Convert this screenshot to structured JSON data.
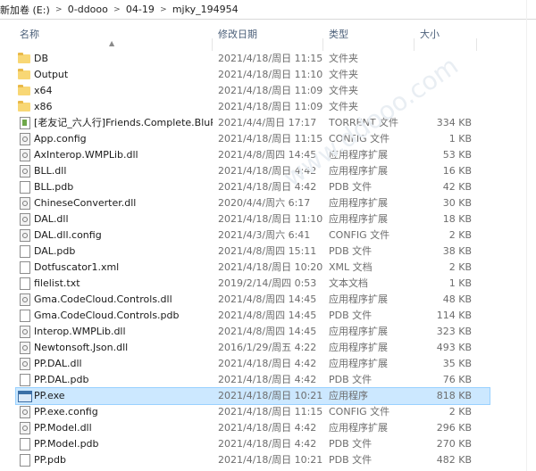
{
  "breadcrumb": [
    "新加卷 (E:)",
    "0-ddooo",
    "04-19",
    "mjky_194954"
  ],
  "columns": {
    "name": "名称",
    "date": "修改日期",
    "type": "类型",
    "size": "大小"
  },
  "watermark": "www.ddooo.com",
  "files": [
    {
      "name": "DB",
      "date": "2021/4/18/周日 11:15",
      "type": "文件夹",
      "size": "",
      "icon": "folder-icon"
    },
    {
      "name": "Output",
      "date": "2021/4/18/周日 11:10",
      "type": "文件夹",
      "size": "",
      "icon": "folder-icon"
    },
    {
      "name": "x64",
      "date": "2021/4/18/周日 11:09",
      "type": "文件夹",
      "size": "",
      "icon": "folder-icon"
    },
    {
      "name": "x86",
      "date": "2021/4/18/周日 11:09",
      "type": "文件夹",
      "size": "",
      "icon": "folder-icon"
    },
    {
      "name": "[老友记_六人行]Friends.Complete.BluR...",
      "date": "2021/4/4/周日 17:17",
      "type": "TORRENT 文件",
      "size": "334 KB",
      "icon": "torrent-file-icon"
    },
    {
      "name": "App.config",
      "date": "2021/4/18/周日 11:15",
      "type": "CONFIG 文件",
      "size": "1 KB",
      "icon": "config-file-icon"
    },
    {
      "name": "AxInterop.WMPLib.dll",
      "date": "2021/4/8/周四 14:45",
      "type": "应用程序扩展",
      "size": "53 KB",
      "icon": "dll-file-icon"
    },
    {
      "name": "BLL.dll",
      "date": "2021/4/18/周日 4:42",
      "type": "应用程序扩展",
      "size": "16 KB",
      "icon": "dll-file-icon"
    },
    {
      "name": "BLL.pdb",
      "date": "2021/4/18/周日 4:42",
      "type": "PDB 文件",
      "size": "42 KB",
      "icon": "file-icon"
    },
    {
      "name": "ChineseConverter.dll",
      "date": "2020/4/4/周六 6:17",
      "type": "应用程序扩展",
      "size": "30 KB",
      "icon": "dll-file-icon"
    },
    {
      "name": "DAL.dll",
      "date": "2021/4/18/周日 11:10",
      "type": "应用程序扩展",
      "size": "18 KB",
      "icon": "dll-file-icon"
    },
    {
      "name": "DAL.dll.config",
      "date": "2021/4/3/周六 6:41",
      "type": "CONFIG 文件",
      "size": "2 KB",
      "icon": "config-file-icon"
    },
    {
      "name": "DAL.pdb",
      "date": "2021/4/8/周四 15:11",
      "type": "PDB 文件",
      "size": "38 KB",
      "icon": "file-icon"
    },
    {
      "name": "Dotfuscator1.xml",
      "date": "2021/4/18/周日 10:20",
      "type": "XML 文档",
      "size": "2 KB",
      "icon": "file-icon"
    },
    {
      "name": "filelist.txt",
      "date": "2019/2/14/周四 0:53",
      "type": "文本文档",
      "size": "1 KB",
      "icon": "file-icon"
    },
    {
      "name": "Gma.CodeCloud.Controls.dll",
      "date": "2021/4/8/周四 14:45",
      "type": "应用程序扩展",
      "size": "48 KB",
      "icon": "dll-file-icon"
    },
    {
      "name": "Gma.CodeCloud.Controls.pdb",
      "date": "2021/4/8/周四 14:45",
      "type": "PDB 文件",
      "size": "114 KB",
      "icon": "file-icon"
    },
    {
      "name": "Interop.WMPLib.dll",
      "date": "2021/4/8/周四 14:45",
      "type": "应用程序扩展",
      "size": "323 KB",
      "icon": "dll-file-icon"
    },
    {
      "name": "Newtonsoft.Json.dll",
      "date": "2016/1/29/周五 4:22",
      "type": "应用程序扩展",
      "size": "493 KB",
      "icon": "dll-file-icon"
    },
    {
      "name": "PP.DAL.dll",
      "date": "2021/4/18/周日 4:42",
      "type": "应用程序扩展",
      "size": "35 KB",
      "icon": "dll-file-icon"
    },
    {
      "name": "PP.DAL.pdb",
      "date": "2021/4/18/周日 4:42",
      "type": "PDB 文件",
      "size": "76 KB",
      "icon": "file-icon"
    },
    {
      "name": "PP.exe",
      "date": "2021/4/18/周日 10:21",
      "type": "应用程序",
      "size": "818 KB",
      "icon": "exe-icon",
      "selected": true
    },
    {
      "name": "PP.exe.config",
      "date": "2021/4/18/周日 11:15",
      "type": "CONFIG 文件",
      "size": "2 KB",
      "icon": "config-file-icon"
    },
    {
      "name": "PP.Model.dll",
      "date": "2021/4/18/周日 4:42",
      "type": "应用程序扩展",
      "size": "296 KB",
      "icon": "dll-file-icon"
    },
    {
      "name": "PP.Model.pdb",
      "date": "2021/4/18/周日 4:42",
      "type": "PDB 文件",
      "size": "270 KB",
      "icon": "file-icon"
    },
    {
      "name": "PP.pdb",
      "date": "2021/4/18/周日 10:21",
      "type": "PDB 文件",
      "size": "482 KB",
      "icon": "file-icon"
    }
  ]
}
